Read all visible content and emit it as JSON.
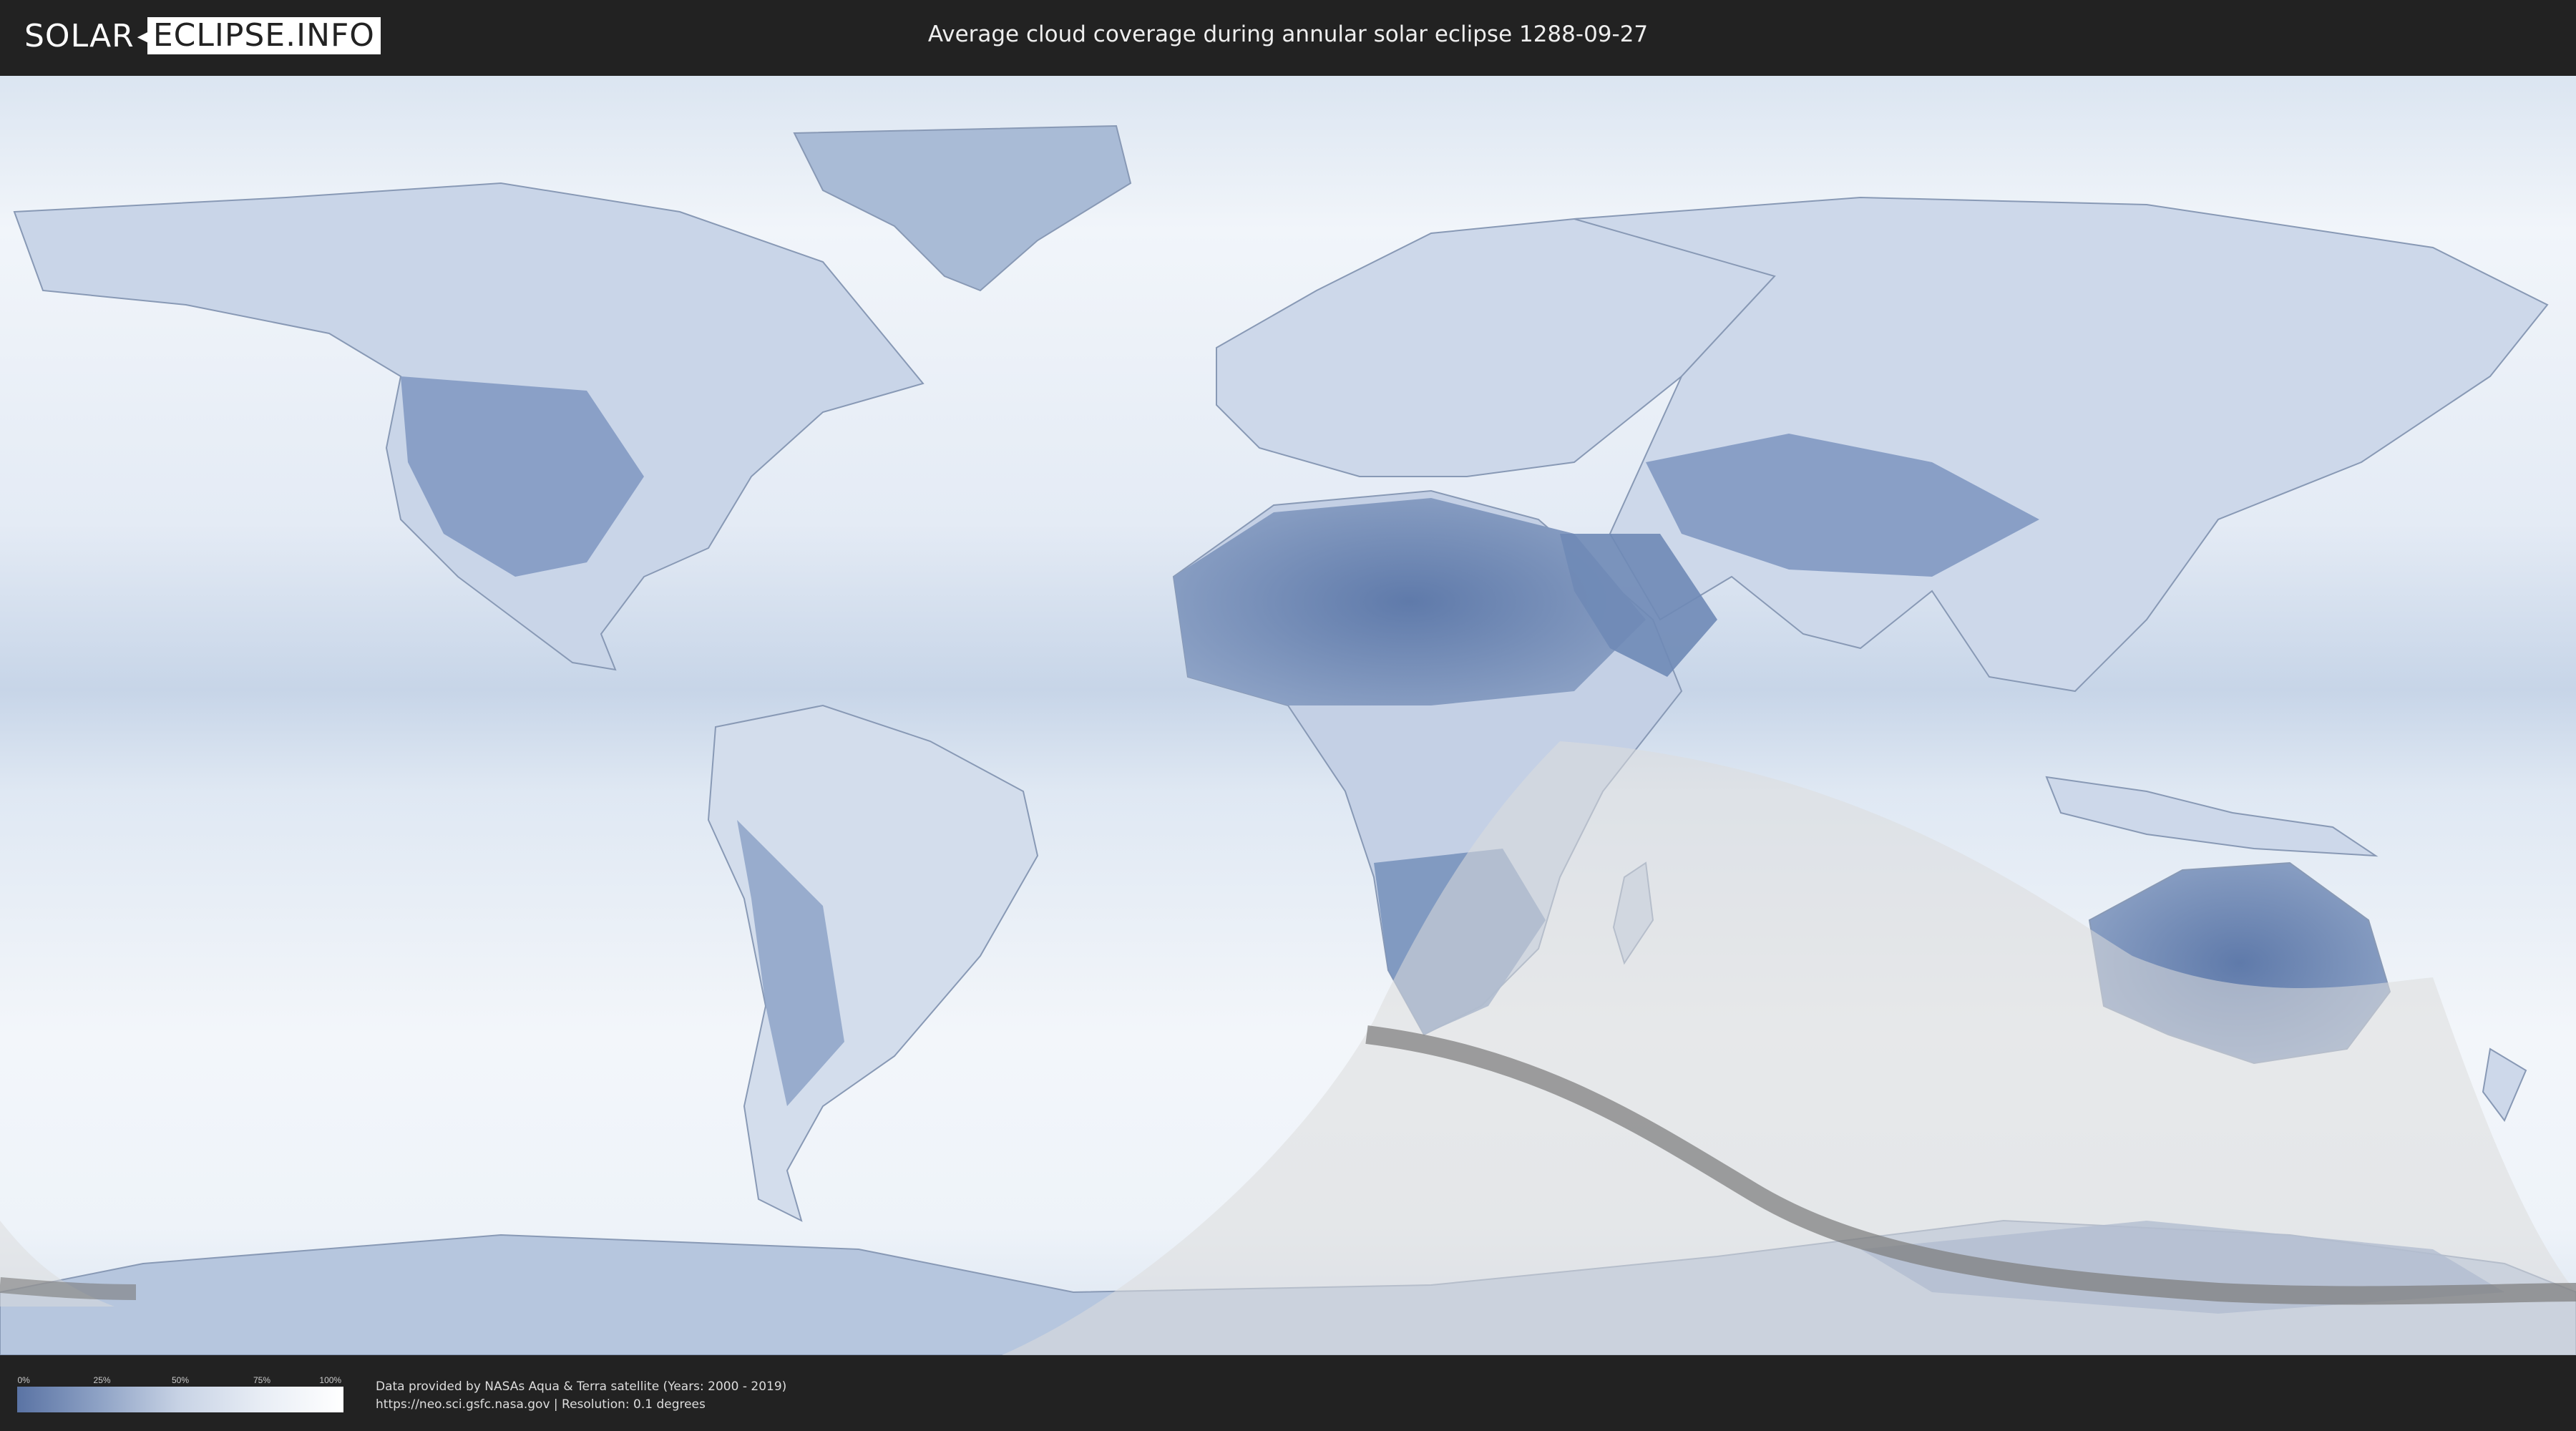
{
  "header": {
    "logo_left": "SOLAR",
    "logo_right": "ECLIPSE.INFO",
    "title": "Average cloud coverage during annular solar eclipse 1288-09-27"
  },
  "legend": {
    "ticks": [
      "0%",
      "25%",
      "50%",
      "75%",
      "100%"
    ],
    "gradient_colors": [
      "#5a73a4",
      "#8ea2c5",
      "#c8d3e5",
      "#e8edf5",
      "#ffffff"
    ]
  },
  "footer": {
    "credit_line1": "Data provided by NASAs Aqua & Terra satellite (Years: 2000 - 2019)",
    "credit_line2": "https://neo.sci.gsfc.nasa.gov | Resolution: 0.1 degrees"
  },
  "map": {
    "colors": {
      "ocean_cloud": "#e9eff7",
      "clear_land": "#6f89b6",
      "eclipse_zone": "#dedede",
      "central_path": "#7a7a7a",
      "borders": "#8899b5"
    },
    "icons": [
      "world-map-icon"
    ]
  }
}
